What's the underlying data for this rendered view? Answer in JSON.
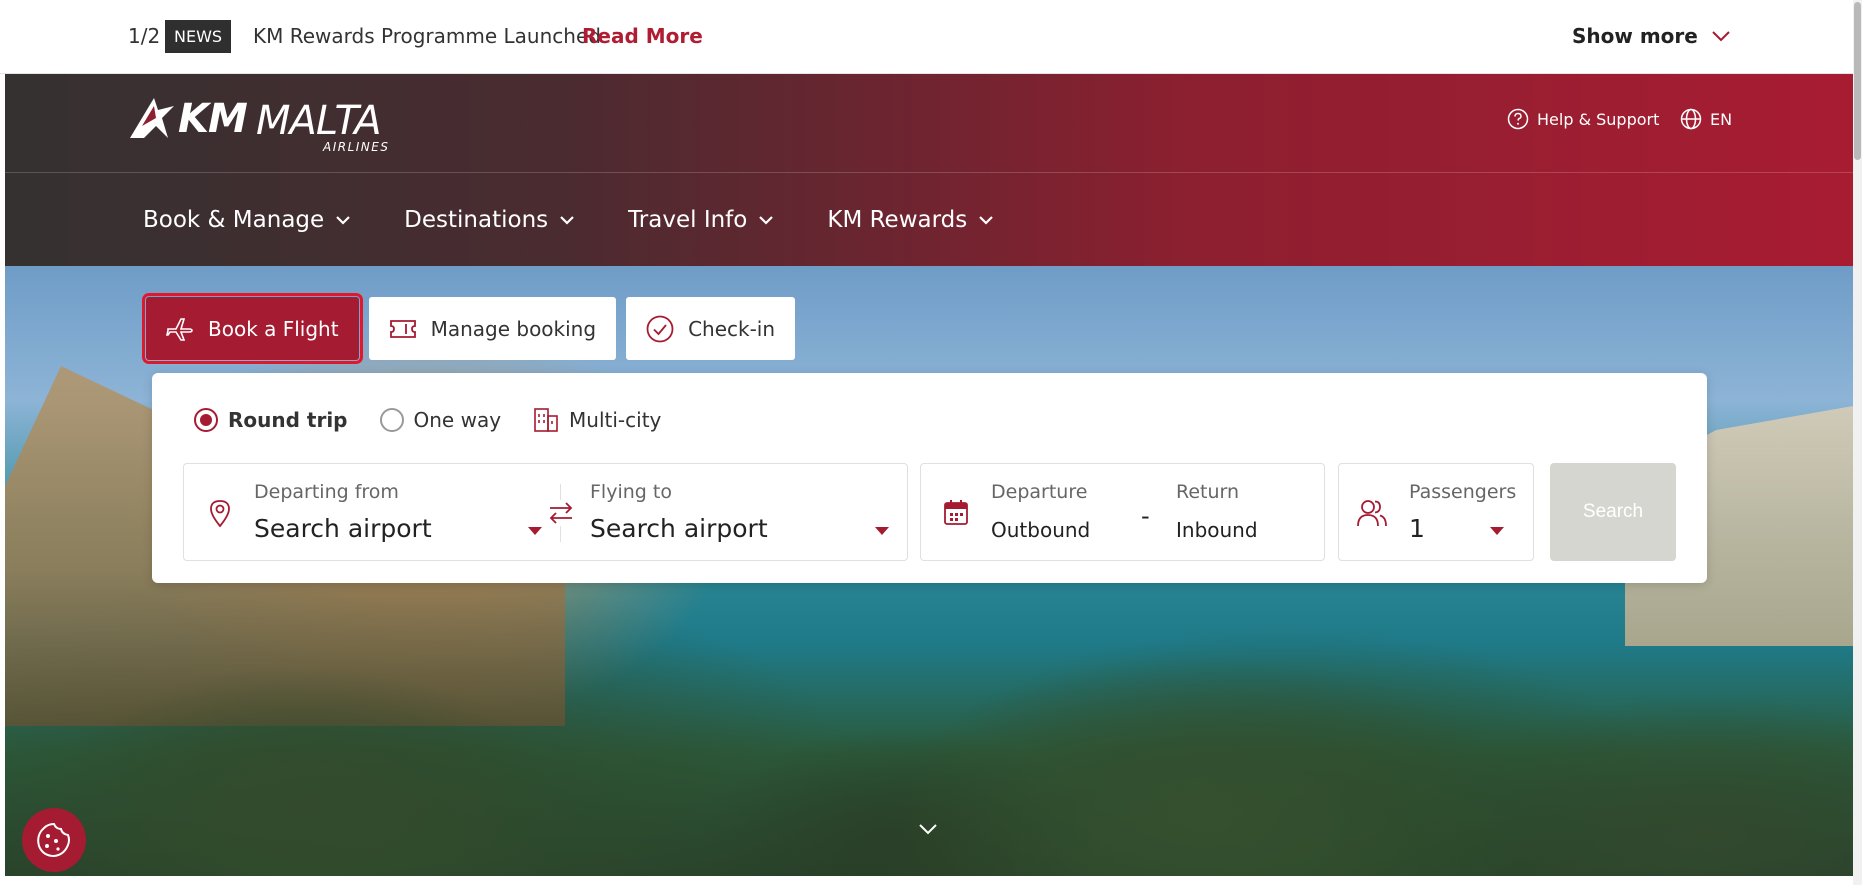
{
  "news": {
    "count": "1/2",
    "tag": "NEWS",
    "text": "KM Rewards Programme Launched",
    "link": "Read More",
    "show_more": "Show more"
  },
  "header": {
    "logo_km": "KM",
    "logo_malta": "MALTA",
    "logo_airlines": "AIRLINES",
    "help": "Help & Support",
    "lang": "EN"
  },
  "nav": {
    "items": [
      {
        "label": "Book & Manage"
      },
      {
        "label": "Destinations"
      },
      {
        "label": "Travel Info"
      },
      {
        "label": "KM Rewards"
      }
    ]
  },
  "tabs": {
    "book": "Book a Flight",
    "manage": "Manage booking",
    "checkin": "Check-in"
  },
  "trip": {
    "round": "Round trip",
    "oneway": "One way",
    "multi": "Multi-city",
    "selected": "Round trip"
  },
  "fields": {
    "from_label": "Departing from",
    "from_value": "Search airport",
    "to_label": "Flying to",
    "to_value": "Search airport",
    "departure_label": "Departure",
    "departure_value": "Outbound",
    "date_sep": "-",
    "return_label": "Return",
    "return_value": "Inbound",
    "pax_label": "Passengers",
    "pax_value": "1"
  },
  "search": "Search",
  "colors": {
    "brand": "#a51b31",
    "search_disabled": "#d6d6d1"
  }
}
